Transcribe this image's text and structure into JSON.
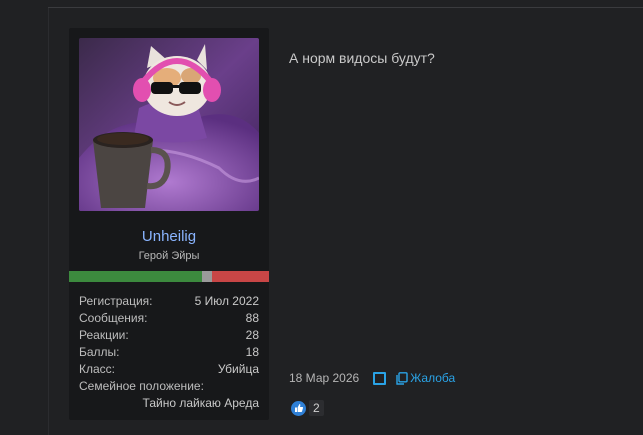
{
  "user": {
    "name": "Unheilig",
    "title": "Герой Эйры",
    "stats": [
      {
        "label": "Регистрация:",
        "value": "5 Июл 2022"
      },
      {
        "label": "Сообщения:",
        "value": "88"
      },
      {
        "label": "Реакции:",
        "value": "28"
      },
      {
        "label": "Баллы:",
        "value": "18"
      },
      {
        "label": "Класс:",
        "value": "Убийца"
      }
    ],
    "family_label": "Семейное положение:",
    "family_value": "Тайно лайкаю Ареда"
  },
  "message": {
    "text": "А норм видосы будут?",
    "date": "18 Мар 2026",
    "report_label": "Жалоба",
    "reaction_count": "2"
  },
  "colors": {
    "link": "#8ab4ff",
    "accent": "#2aa3e6",
    "rep_good": "#3c8a3e",
    "rep_bad": "#c84646"
  },
  "icons": {
    "bookmark": "bookmark-icon",
    "report": "report-icon",
    "like": "thumbs-up-icon"
  }
}
